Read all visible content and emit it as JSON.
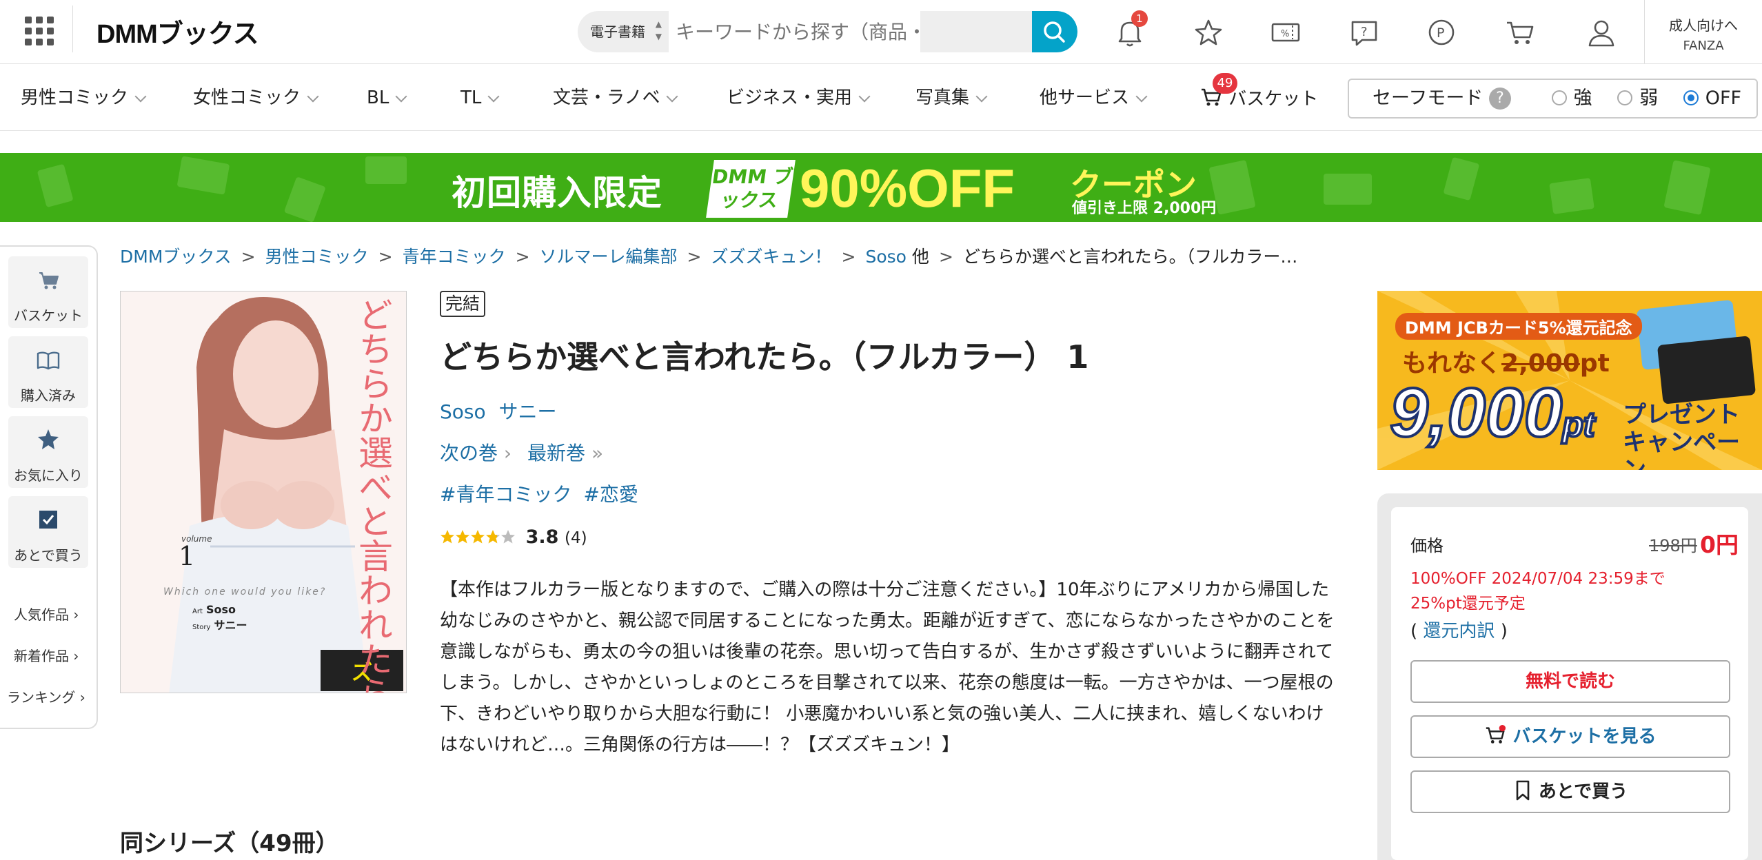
{
  "header": {
    "logo": "DMMブックス",
    "search_category": "電子書籍",
    "search_placeholder": "キーワードから探す（商品・サービス…",
    "notification_count": "1",
    "adult_link": "成人向けへ",
    "adult_sub": "FANZA"
  },
  "nav": {
    "items": [
      "男性コミック",
      "女性コミック",
      "BL",
      "TL",
      "文芸・ラノベ",
      "ビジネス・実用",
      "写真集",
      "他サービス"
    ],
    "basket_label": "バスケット",
    "basket_count": "49",
    "safe_mode_label": "セーフモード",
    "safe_mode_help": "?",
    "safe_options": [
      "強",
      "弱",
      "OFF"
    ],
    "safe_selected": "OFF"
  },
  "banner": {
    "text1": "初回購入限定",
    "tag": "DMM ブックス",
    "text2": "90%OFF",
    "text3": "クーポン",
    "text4": "値引き上限 2,000円"
  },
  "sidebar": {
    "boxes": [
      "バスケット",
      "購入済み",
      "お気に入り",
      "あとで買う"
    ],
    "links": [
      "人気作品",
      "新着作品",
      "ランキング"
    ]
  },
  "breadcrumb": [
    "DMMブックス",
    "男性コミック",
    "青年コミック",
    "ソルマーレ編集部",
    "ズズズキュン！",
    "Soso",
    "どちらか選べと言われたら。（フルカラー…"
  ],
  "breadcrumb_suffix": "他",
  "product": {
    "status": "完結",
    "title": "どちらか選べと言われたら。（フルカラー） 1",
    "authors": [
      "Soso",
      "サニー"
    ],
    "next_volume": "次の巻",
    "latest_volume": "最新巻",
    "tags": [
      "#青年コミック",
      "#恋愛"
    ],
    "rating": "3.8",
    "rating_value": 3.8,
    "review_count": "(4)",
    "description": "【本作はフルカラー版となりますので、ご購入の際は十分ご注意ください。】10年ぶりにアメリカから帰国した幼なじみのさやかと、親公認で同居することになった勇太。距離が近すぎて、恋にならなかったさやかのことを意識しながらも、勇太の今の狙いは後輩の花奈。思い切って告白するが、生かさず殺さずいいように翻弄されてしまう。しかし、さやかといっしょのところを目撃されて以来、花奈の態度は一転。一方さやかは、一つ屋根の下、きわどいやり取りから大胆な行動に！ 小悪魔かわいい系と気の強い美人、二人に挟まれ、嬉しくないわけはないけれど…。三角関係の行方は――！？【ズズズキュン！】",
    "cover_title": "どちらか選べと言われたら。",
    "cover_volume_label": "volume",
    "cover_volume": "1",
    "cover_english": "Which one would you like?",
    "cover_art_label": "Art",
    "cover_art": "Soso",
    "cover_story_label": "Story",
    "cover_story": "サニー"
  },
  "series_heading": "同シリーズ（49冊）",
  "ad": {
    "line1": "DMM JCBカード5%還元記念",
    "line2_prefix": "もれなく",
    "line2_old": "2,000",
    "line2_unit": "pt",
    "line3": "9,000",
    "line3_unit": "pt",
    "line4a": "プレゼント",
    "line4b": "キャンペーン"
  },
  "price": {
    "label": "価格",
    "old": "198円",
    "new": "0円",
    "promo": "100%OFF 2024/07/04 23:59まで",
    "points": "25%pt還元予定",
    "breakdown_open": "(",
    "breakdown_link": "還元内訳",
    "breakdown_close": ")",
    "read_free": "無料で読む",
    "view_basket": "バスケットを見る",
    "buy_later": "あとで買う"
  },
  "colors": {
    "accent": "#04a3c9",
    "link": "#1d6fa5",
    "red": "#e5202e",
    "banner": "#3fae15"
  }
}
